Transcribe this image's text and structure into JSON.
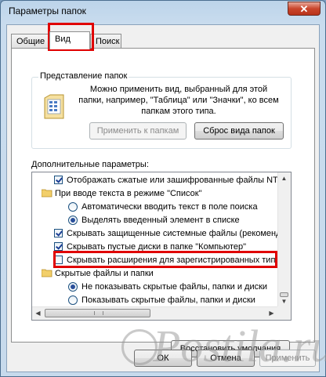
{
  "window": {
    "title": "Параметры папок",
    "close_label": "✕"
  },
  "tabs": [
    {
      "label": "Общие",
      "active": false
    },
    {
      "label": "Вид",
      "active": true
    },
    {
      "label": "Поиск",
      "active": false
    }
  ],
  "folder_view": {
    "group_title": "Представление папок",
    "description": "Можно применить вид, выбранный для этой папки, например, \"Таблица\" или \"Значки\", ко всем папкам этого типа.",
    "apply_label": "Применить к папкам",
    "reset_label": "Сброс вида папок"
  },
  "advanced": {
    "label": "Дополнительные параметры:",
    "items": [
      {
        "kind": "checkbox",
        "checked": true,
        "label": "Отображать сжатые или зашифрованные файлы NTFS"
      },
      {
        "kind": "folder",
        "label": "При вводе текста в режиме \"Список\""
      },
      {
        "kind": "radio",
        "checked": false,
        "label": "Автоматически вводить текст в поле поиска"
      },
      {
        "kind": "radio",
        "checked": true,
        "label": "Выделять введенный элемент в списке"
      },
      {
        "kind": "checkbox",
        "checked": true,
        "label": "Скрывать защищенные системные файлы (рекомендуется)"
      },
      {
        "kind": "checkbox",
        "checked": true,
        "label": "Скрывать пустые диски в папке \"Компьютер\""
      },
      {
        "kind": "checkbox",
        "checked": false,
        "label": "Скрывать расширения для зарегистрированных типов"
      },
      {
        "kind": "folder",
        "label": "Скрытые файлы и папки"
      },
      {
        "kind": "radio",
        "checked": true,
        "label": "Не показывать скрытые файлы, папки и диски"
      },
      {
        "kind": "radio",
        "checked": false,
        "label": "Показывать скрытые файлы, папки и диски"
      }
    ]
  },
  "restore_label": "Восстановить умолчания",
  "footer": {
    "ok_label": "ОК",
    "cancel_label": "Отмена",
    "apply_label": "Применить"
  },
  "watermark": "Postila.ru",
  "colors": {
    "highlight": "#e00000",
    "checkmark": "#1c3f94",
    "titlebar": "#bcd4ea",
    "close_button": "#c9462c"
  }
}
